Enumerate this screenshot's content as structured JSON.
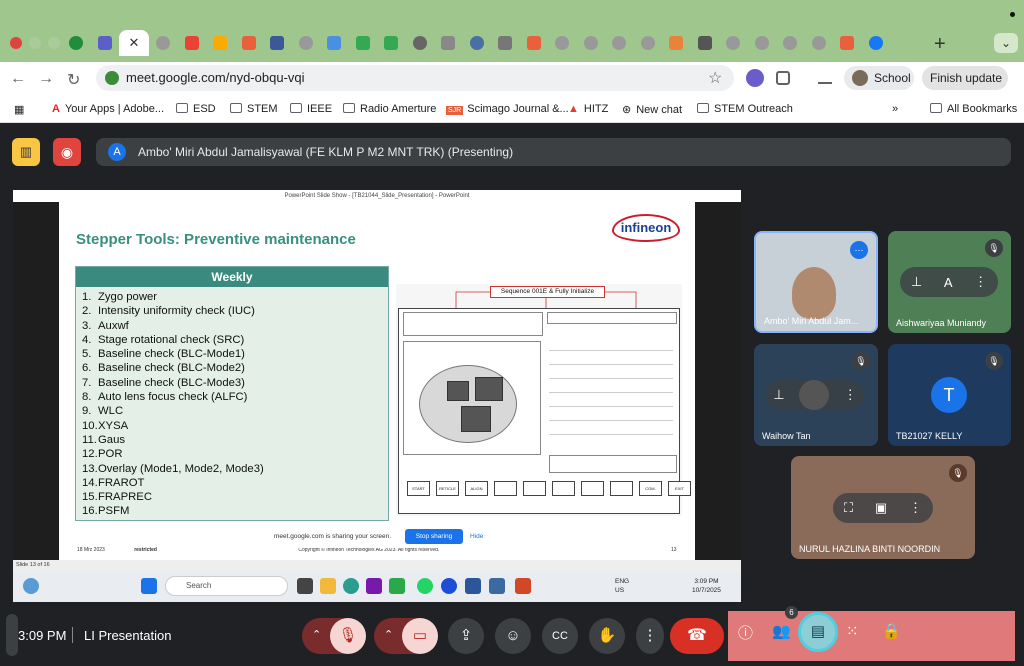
{
  "browser": {
    "url": "meet.google.com/nyd-obqu-vqi",
    "profile_label": "School",
    "update_label": "Finish update",
    "bookmarks": [
      "Your Apps | Adobe...",
      "ESD",
      "STEM",
      "IEEE",
      "Radio Amerture",
      "Scimago Journal &...",
      "HITZ",
      "New chat",
      "STEM Outreach"
    ],
    "all_bookmarks": "All Bookmarks"
  },
  "meet": {
    "presenter_initial": "A",
    "presenting_text": "Ambo' Miri Abdul Jamalisyawal (FE KLM P M2 MNT TRK) (Presenting)",
    "clock": "3:09 PM",
    "meeting_name": "LI Presentation",
    "people_count": "6"
  },
  "ppt": {
    "window_title": "PowerPoint Slide Show - [TB21044_Slide_Presentation] - PowerPoint",
    "slide_title": "Stepper Tools: Preventive maintenance",
    "logo": "infineon",
    "table_header": "Weekly",
    "items": [
      {
        "n": "1.",
        "t": "Zygo power"
      },
      {
        "n": "2.",
        "t": "Intensity uniformity check (IUC)"
      },
      {
        "n": "3.",
        "t": "Auxwf"
      },
      {
        "n": "4.",
        "t": "Stage rotational check (SRC)"
      },
      {
        "n": "5.",
        "t": "Baseline check (BLC-Mode1)"
      },
      {
        "n": "6.",
        "t": "Baseline check (BLC-Mode2)"
      },
      {
        "n": "7.",
        "t": "Baseline check (BLC-Mode3)"
      },
      {
        "n": "8.",
        "t": "Auto lens focus check (ALFC)"
      },
      {
        "n": "9.",
        "t": "WLC"
      },
      {
        "n": "10.",
        "t": "XYSA"
      },
      {
        "n": "11.",
        "t": "Gaus"
      },
      {
        "n": "12.",
        "t": "POR"
      },
      {
        "n": "13.",
        "t": "Overlay (Mode1, Mode2, Mode3)"
      },
      {
        "n": "14.",
        "t": "FRAROT"
      },
      {
        "n": "15.",
        "t": "FRAPREC"
      },
      {
        "n": "16.",
        "t": "PSFM"
      }
    ],
    "sequence_label": "Sequence 001E & Fully Initialize",
    "footer_date": "18 Mrz 2023",
    "footer_class": "restricted",
    "footer_copy": "Copyright © Infineon Technologies AG 2023. All rights reserved.",
    "page_number": "13",
    "status": "Slide 13 of 16"
  },
  "share_notice": {
    "text": "meet.google.com is sharing your screen.",
    "stop": "Stop sharing",
    "hide": "Hide"
  },
  "taskbar": {
    "search": "Search",
    "lang1": "ENG",
    "lang2": "US",
    "time": "3:09 PM",
    "date": "10/7/2025"
  },
  "participants": [
    {
      "name": "Ambo' Miri Abdul Jam..."
    },
    {
      "name": "Aishwariyaa Muniandy"
    },
    {
      "name": "Waihow Tan"
    },
    {
      "name": "TB21027 KELLY",
      "initial": "T"
    },
    {
      "name": "NURUL HAZLINA BINTI NOORDIN"
    }
  ]
}
